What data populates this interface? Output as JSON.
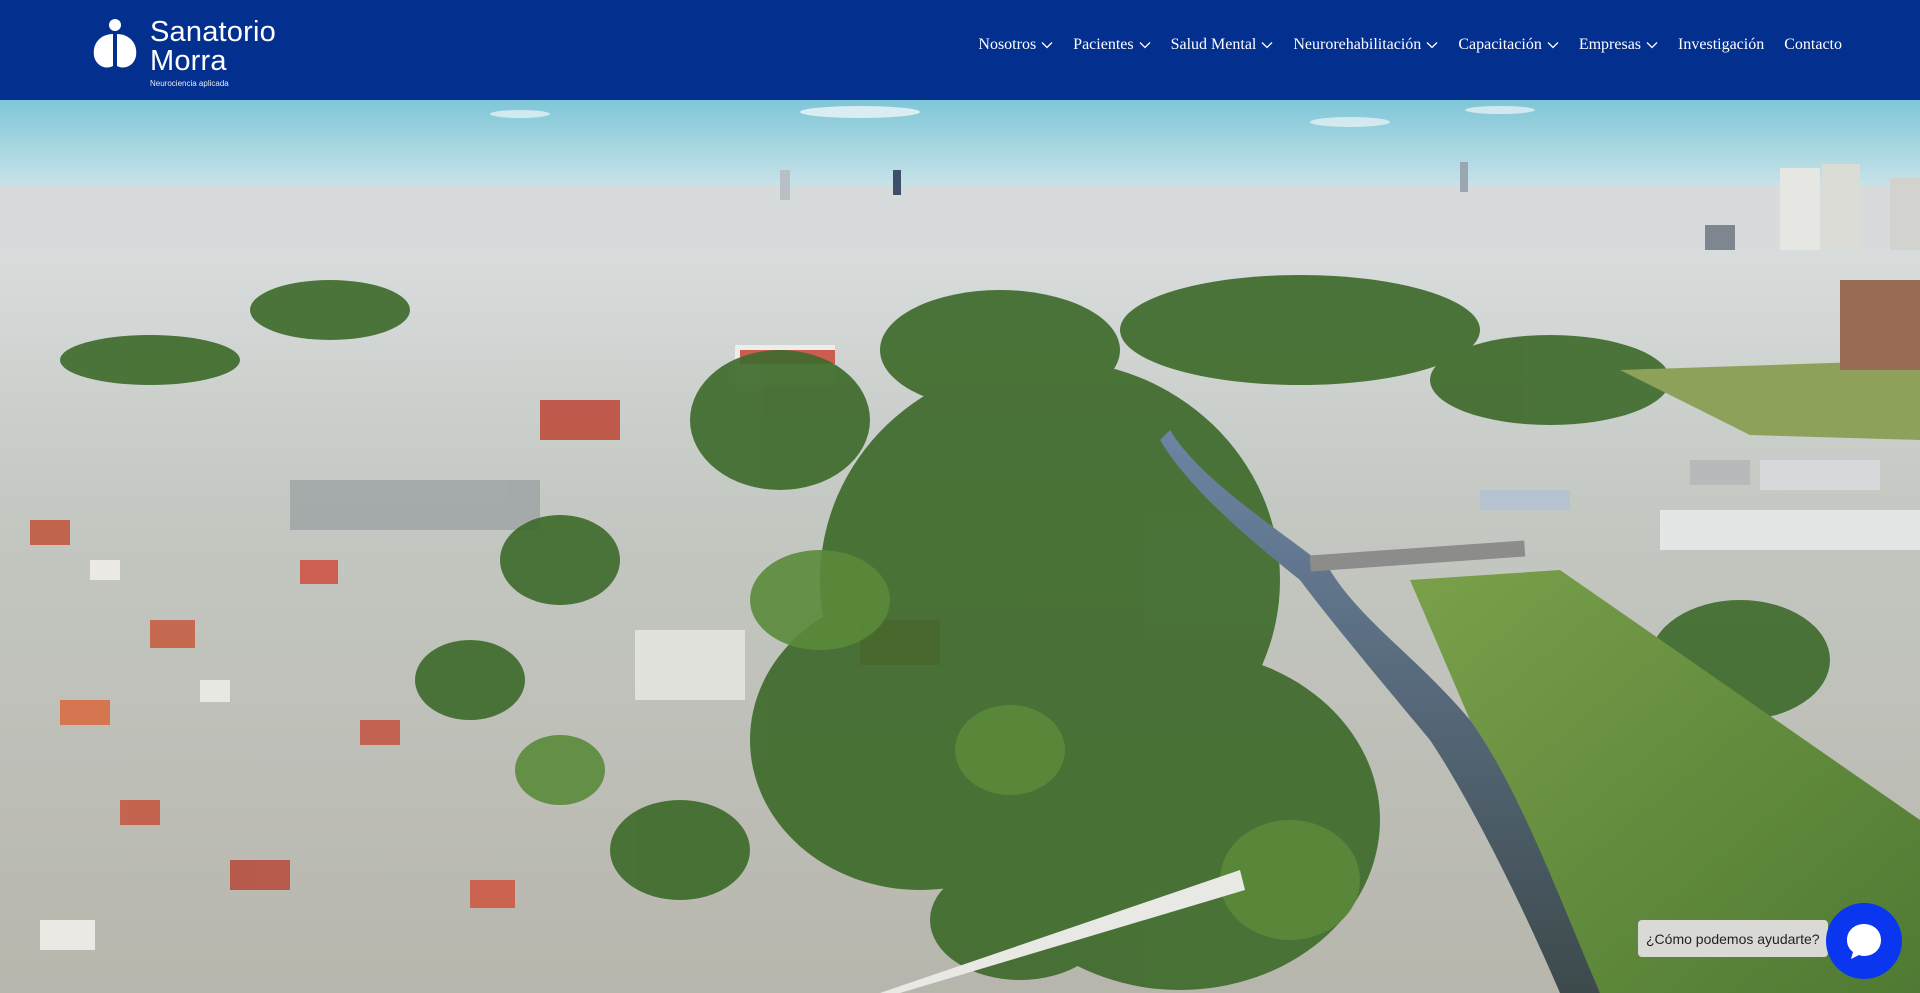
{
  "header": {
    "logo": {
      "line1": "Sanatorio",
      "line2": "Morra",
      "tagline": "Neurociencia aplicada"
    },
    "nav": [
      {
        "label": "Nosotros",
        "has_dropdown": true,
        "icon": "chevron-down-icon"
      },
      {
        "label": "Pacientes",
        "has_dropdown": true,
        "icon": "chevron-down-icon"
      },
      {
        "label": "Salud Mental",
        "has_dropdown": true,
        "icon": "chevron-down-icon"
      },
      {
        "label": "Neurorehabilitación",
        "has_dropdown": true,
        "icon": "chevron-down-icon"
      },
      {
        "label": "Capacitación",
        "has_dropdown": true,
        "icon": "chevron-down-icon"
      },
      {
        "label": "Empresas",
        "has_dropdown": true,
        "icon": "chevron-down-icon"
      },
      {
        "label": "Investigación",
        "has_dropdown": false
      },
      {
        "label": "Contacto",
        "has_dropdown": false
      }
    ]
  },
  "chat": {
    "prompt": "¿Cómo podemos ayudarte?",
    "icon": "chat-icon"
  },
  "colors": {
    "header_bg": "#03308f",
    "chat_button": "#0b36f0",
    "chat_label_bg": "#d9d9d6"
  }
}
